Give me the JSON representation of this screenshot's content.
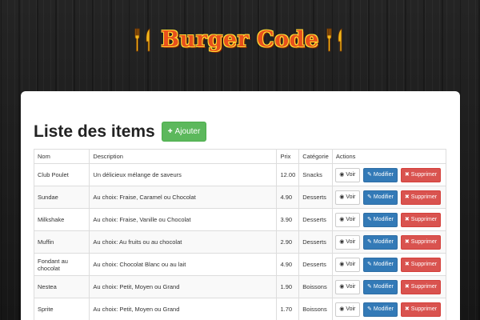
{
  "header": {
    "logo_text": "Burger Code",
    "left_icon": "cutlery-icon",
    "right_icon": "cutlery-icon"
  },
  "main": {
    "title": "Liste des items",
    "add_button_label": "Ajouter",
    "add_button_icon": "plus-icon"
  },
  "table": {
    "headers": [
      "Nom",
      "Description",
      "Prix",
      "Catégorie",
      "Actions"
    ],
    "rows": [
      {
        "nom": "Club Poulet",
        "description": "Un délicieux mélange de saveurs",
        "prix": "12.00",
        "categorie": "Snacks"
      },
      {
        "nom": "Sundae",
        "description": "Au choix: Fraise, Caramel ou Chocolat",
        "prix": "4.90",
        "categorie": "Desserts"
      },
      {
        "nom": "Milkshake",
        "description": "Au choix: Fraise, Vanille ou Chocolat",
        "prix": "3.90",
        "categorie": "Desserts"
      },
      {
        "nom": "Muffin",
        "description": "Au choix: Au fruits ou au chocolat",
        "prix": "2.90",
        "categorie": "Desserts"
      },
      {
        "nom": "Fondant au chocolat",
        "description": "Au choix: Chocolat Blanc ou au lait",
        "prix": "4.90",
        "categorie": "Desserts"
      },
      {
        "nom": "Nestea",
        "description": "Au choix: Petit, Moyen ou Grand",
        "prix": "1.90",
        "categorie": "Boissons"
      },
      {
        "nom": "Sprite",
        "description": "Au choix: Petit, Moyen ou Grand",
        "prix": "1.70",
        "categorie": "Boissons"
      }
    ]
  },
  "actions": {
    "view_label": "Voir",
    "edit_label": "Modifier",
    "delete_label": "Supprimer",
    "view_icon": "eye-icon",
    "edit_icon": "pencil-icon",
    "delete_icon": "remove-icon"
  },
  "colors": {
    "logo_fill": "#e8501c",
    "logo_outline": "#ffdd33",
    "add_button": "#5cb85c",
    "edit_button": "#337ab7",
    "delete_button": "#d9534f",
    "background": "#1b1b1b"
  }
}
